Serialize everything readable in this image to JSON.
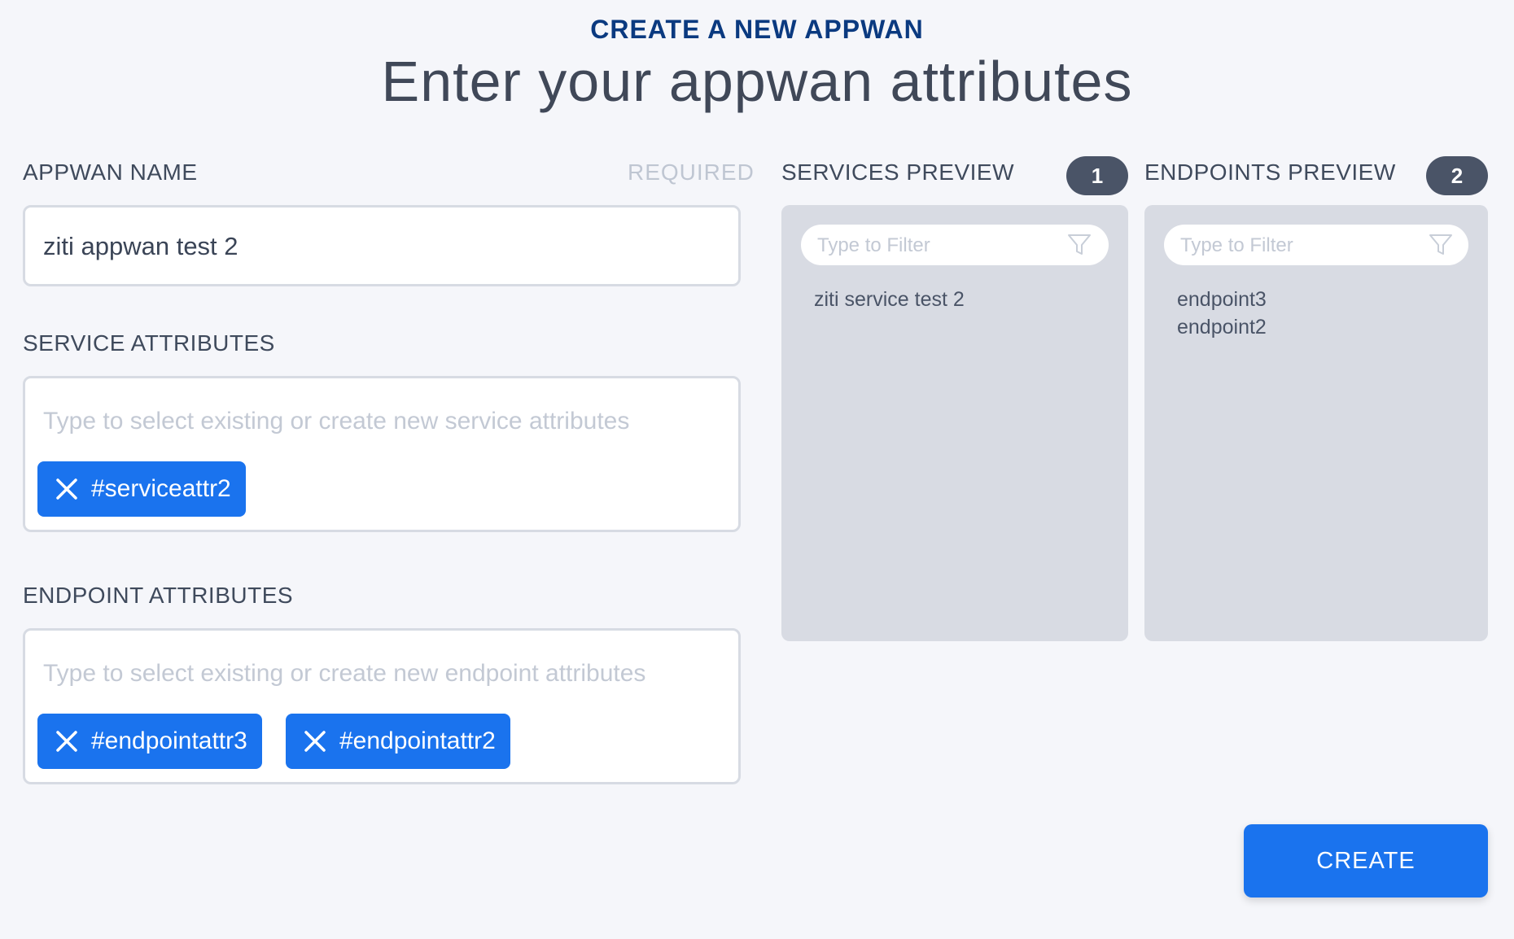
{
  "header": {
    "eyebrow": "CREATE A NEW APPWAN",
    "title": "Enter your appwan attributes"
  },
  "form": {
    "name_label": "APPWAN NAME",
    "required_label": "REQUIRED",
    "name_value": "ziti appwan test 2",
    "service_label": "SERVICE ATTRIBUTES",
    "service_placeholder": "Type to select existing or create new service attributes",
    "service_chips": [
      "#serviceattr2"
    ],
    "endpoint_label": "ENDPOINT ATTRIBUTES",
    "endpoint_placeholder": "Type to select existing or create new endpoint attributes",
    "endpoint_chips": [
      "#endpointattr3",
      "#endpointattr2"
    ]
  },
  "services_preview": {
    "label": "SERVICES PREVIEW",
    "count": "1",
    "filter_placeholder": "Type to Filter",
    "items": [
      "ziti service test 2"
    ]
  },
  "endpoints_preview": {
    "label": "ENDPOINTS PREVIEW",
    "count": "2",
    "filter_placeholder": "Type to Filter",
    "items": [
      "endpoint3",
      "endpoint2"
    ]
  },
  "actions": {
    "create_label": "CREATE"
  },
  "icons": {
    "chip_remove": "close-icon",
    "filter": "filter-funnel-icon"
  },
  "colors": {
    "accent": "#1a73ee",
    "eyebrow": "#0b3a80",
    "badge": "#4a5467"
  }
}
